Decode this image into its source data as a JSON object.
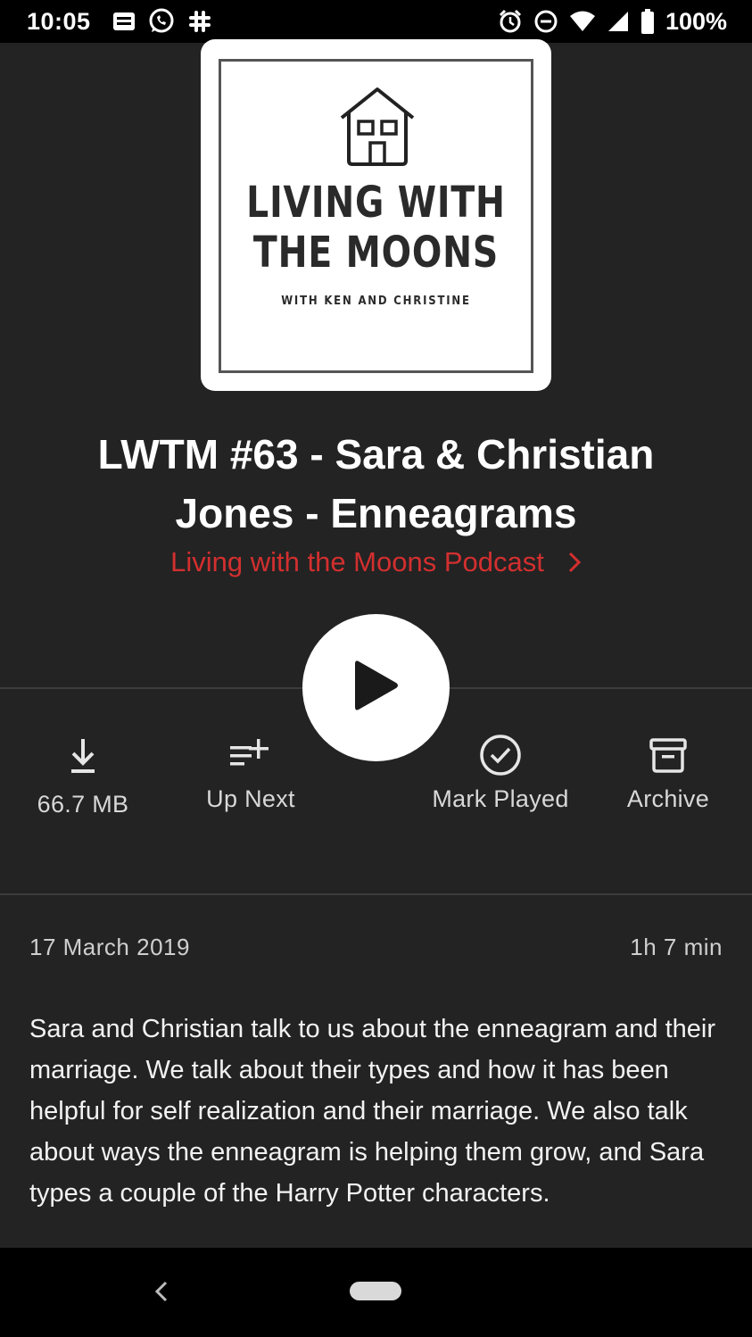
{
  "status_bar": {
    "time": "10:05",
    "battery": "100%",
    "icons": [
      "news-icon",
      "whatsapp-icon",
      "slack-icon",
      "alarm-icon",
      "do-not-disturb-icon",
      "wifi-icon",
      "cell-signal-icon",
      "battery-icon"
    ]
  },
  "artwork": {
    "title_line1": "LIVING WITH",
    "title_line2": "THE MOONS",
    "subtitle": "WITH KEN AND CHRISTINE"
  },
  "episode": {
    "title": "LWTM #63 - Sara & Christian Jones - Enneagrams",
    "podcast_name": "Living with the Moons Podcast",
    "date": "17 March 2019",
    "duration": "1h 7 min",
    "description": "Sara and Christian talk to us about the enneagram and their marriage. We talk about their types and how it has been helpful for self realization and their marriage. We also talk about ways the enneagram is helping them grow, and Sara types a couple of the Harry Potter characters."
  },
  "actions": {
    "download": "66.7 MB",
    "up_next": "Up Next",
    "mark_played": "Mark Played",
    "archive": "Archive"
  },
  "colors": {
    "background": "#232323",
    "accent": "#d32f2f",
    "text": "#ffffff"
  }
}
